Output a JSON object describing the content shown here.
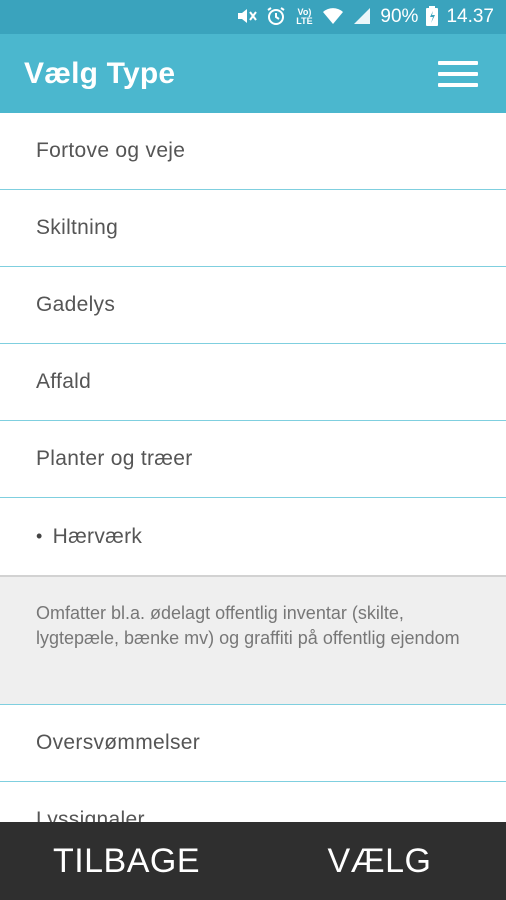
{
  "status_bar": {
    "battery": "90%",
    "time": "14.37",
    "icons": [
      "mute-icon",
      "alarm-icon",
      "volte-icon",
      "wifi-icon",
      "signal-icon",
      "battery-icon"
    ],
    "volte_label": "Vo) LTE"
  },
  "app_bar": {
    "title": "Vælg Type",
    "menu_icon": "hamburger-menu-icon"
  },
  "list": {
    "items": [
      {
        "label": "Fortove og veje"
      },
      {
        "label": "Skiltning"
      },
      {
        "label": "Gadelys"
      },
      {
        "label": "Affald"
      },
      {
        "label": "Planter og træer"
      },
      {
        "label": "Hærværk",
        "selected": true,
        "bullet": "•"
      }
    ],
    "selected_description": "Omfatter bl.a. ødelagt offentlig inventar (skilte, lygtepæle, bænke mv) og graffiti på offentlig ejendom",
    "items_after": [
      {
        "label": "Oversvømmelser"
      },
      {
        "label": "Lyssignaler"
      }
    ]
  },
  "bottom_bar": {
    "back_label": "TILBAGE",
    "select_label": "VÆLG"
  },
  "colors": {
    "status_bar": "#3aa3bd",
    "app_bar": "#4bb7ce",
    "divider": "#7fcfdf",
    "description_bg": "#efefef",
    "bottom_bar": "#2f2f2f"
  }
}
